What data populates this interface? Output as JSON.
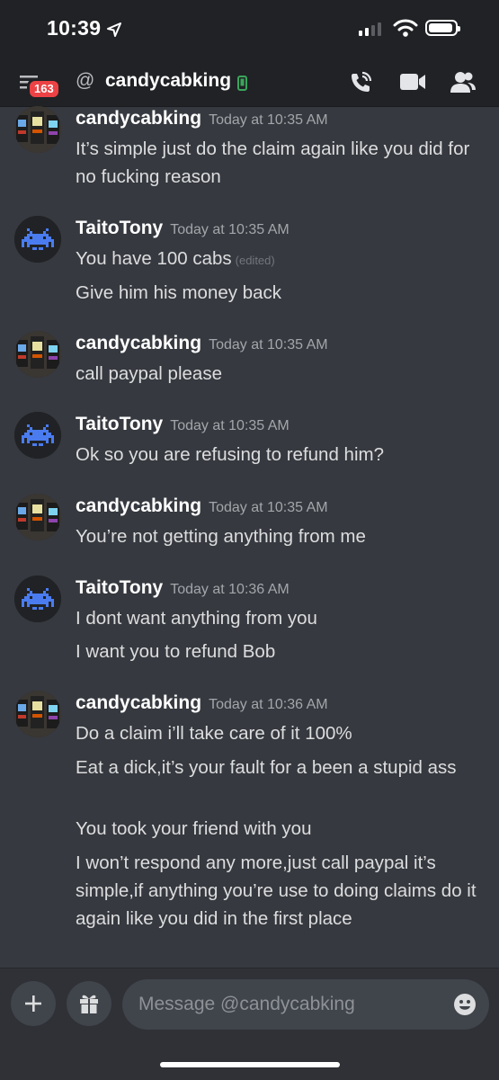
{
  "status_bar": {
    "time": "10:39"
  },
  "header": {
    "badge_count": "163",
    "at_symbol": "@",
    "title": "candycabking"
  },
  "messages": [
    {
      "author": "candycabking",
      "timestamp": "Today at 10:35 AM",
      "avatar": "arcade-cabinets",
      "lines": [
        "It’s simple just do the claim again like you did for no fucking reason"
      ]
    },
    {
      "author": "TaitoTony",
      "timestamp": "Today at 10:35 AM",
      "avatar": "space-invader",
      "lines": [
        "You have 100 cabs",
        "Give him his money back"
      ],
      "edited_label": "(edited)"
    },
    {
      "author": "candycabking",
      "timestamp": "Today at 10:35 AM",
      "avatar": "arcade-cabinets",
      "lines": [
        "call paypal please"
      ]
    },
    {
      "author": "TaitoTony",
      "timestamp": "Today at 10:35 AM",
      "avatar": "space-invader",
      "lines": [
        "Ok so you are refusing to refund him?"
      ]
    },
    {
      "author": "candycabking",
      "timestamp": "Today at 10:35 AM",
      "avatar": "arcade-cabinets",
      "lines": [
        "You’re not getting anything from me"
      ]
    },
    {
      "author": "TaitoTony",
      "timestamp": "Today at 10:36 AM",
      "avatar": "space-invader",
      "lines": [
        "I dont want anything from you",
        "I want you to refund Bob"
      ]
    },
    {
      "author": "candycabking",
      "timestamp": "Today at 10:36 AM",
      "avatar": "arcade-cabinets",
      "lines": [
        "Do a claim i’ll take care of it 100%",
        "Eat a dick,it’s your fault for a been a stupid ass",
        "You took your friend with you",
        "I won’t respond any more,just call paypal it’s simple,if anything you’re use to doing claims do it again like you did in the first place"
      ]
    }
  ],
  "composer": {
    "placeholder": "Message @candycabking"
  },
  "colors": {
    "background": "#36393f",
    "header": "#202225",
    "badge": "#ed4245",
    "mobile_status": "#3ba55c",
    "invader": "#4a7cf0"
  }
}
